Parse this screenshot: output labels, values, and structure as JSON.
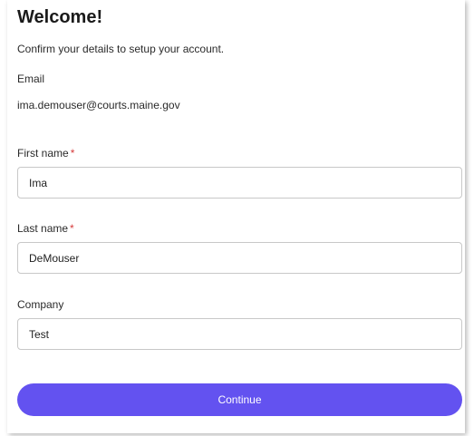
{
  "header": {
    "title": "Welcome!",
    "subtitle": "Confirm your details to setup your account."
  },
  "email": {
    "label": "Email",
    "value": "ima.demouser@courts.maine.gov"
  },
  "fields": {
    "first_name": {
      "label": "First name",
      "required_mark": "*",
      "value": "Ima"
    },
    "last_name": {
      "label": "Last name",
      "required_mark": "*",
      "value": "DeMouser"
    },
    "company": {
      "label": "Company",
      "value": "Test"
    }
  },
  "actions": {
    "continue_label": "Continue"
  },
  "colors": {
    "primary": "#6352f0",
    "required": "#d63b3b"
  }
}
